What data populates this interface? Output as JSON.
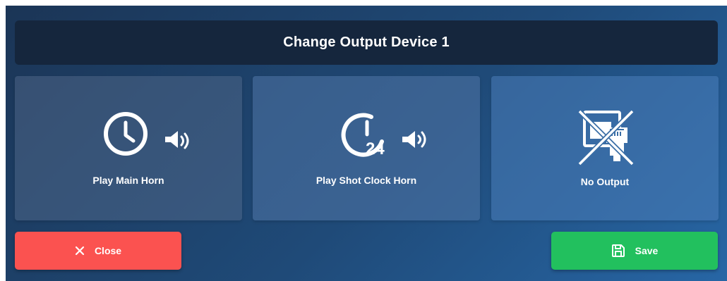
{
  "dialog": {
    "title": "Change Output Device 1"
  },
  "options": [
    {
      "label": "Play Main Horn",
      "icon": "clock-icon",
      "secondary_icon": "speaker-icon"
    },
    {
      "label": "Play Shot Clock Horn",
      "icon": "shot-clock-24-icon",
      "secondary_icon": "speaker-icon",
      "icon_text": "24"
    },
    {
      "label": "No Output",
      "icon": "network-port-disabled-icon"
    }
  ],
  "actions": {
    "close_label": "Close",
    "close_icon": "x-icon",
    "save_label": "Save",
    "save_icon": "floppy-disk-icon"
  },
  "colors": {
    "title_bar": "#15263d",
    "close_button": "#fb5250",
    "save_button": "#22c05e"
  }
}
